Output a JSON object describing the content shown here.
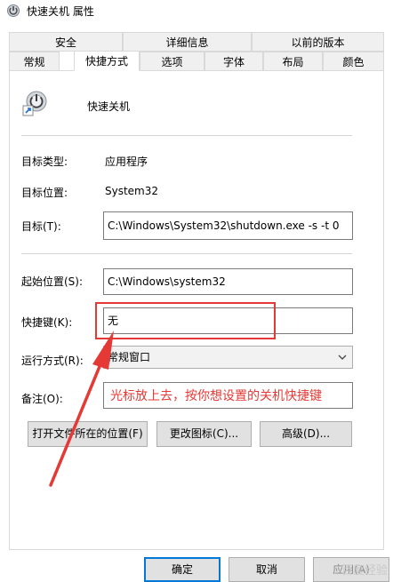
{
  "window": {
    "title": "快速关机 属性"
  },
  "tabs_top": [
    {
      "label": "安全"
    },
    {
      "label": "详细信息"
    },
    {
      "label": "以前的版本"
    }
  ],
  "tabs_bottom": [
    {
      "label": "常规"
    },
    {
      "label": "快捷方式"
    },
    {
      "label": "选项"
    },
    {
      "label": "字体"
    },
    {
      "label": "布局"
    },
    {
      "label": "颜色"
    }
  ],
  "shortcut": {
    "name": "快速关机"
  },
  "fields": {
    "target_type_label": "目标类型:",
    "target_type_value": "应用程序",
    "target_location_label": "目标位置:",
    "target_location_value": "System32",
    "target_label": "目标(T):",
    "target_value": "C:\\Windows\\System32\\shutdown.exe -s -t 0",
    "start_in_label": "起始位置(S):",
    "start_in_value": "C:\\Windows\\system32",
    "hotkey_label": "快捷键(K):",
    "hotkey_value": "无",
    "run_label": "运行方式(R):",
    "run_value": "常规窗口",
    "comment_label": "备注(O):",
    "comment_value": ""
  },
  "buttons": {
    "open_location": "打开文件所在的位置(F)",
    "change_icon": "更改图标(C)...",
    "advanced": "高级(D)...",
    "ok": "确定",
    "cancel": "取消",
    "apply": "应用(A)"
  },
  "annotation": {
    "text": "光标放上去，按你想设置的关机快捷键"
  },
  "watermark": "百度经验",
  "colors": {
    "annotation": "#e53935",
    "button_focus": "#0078d7"
  }
}
